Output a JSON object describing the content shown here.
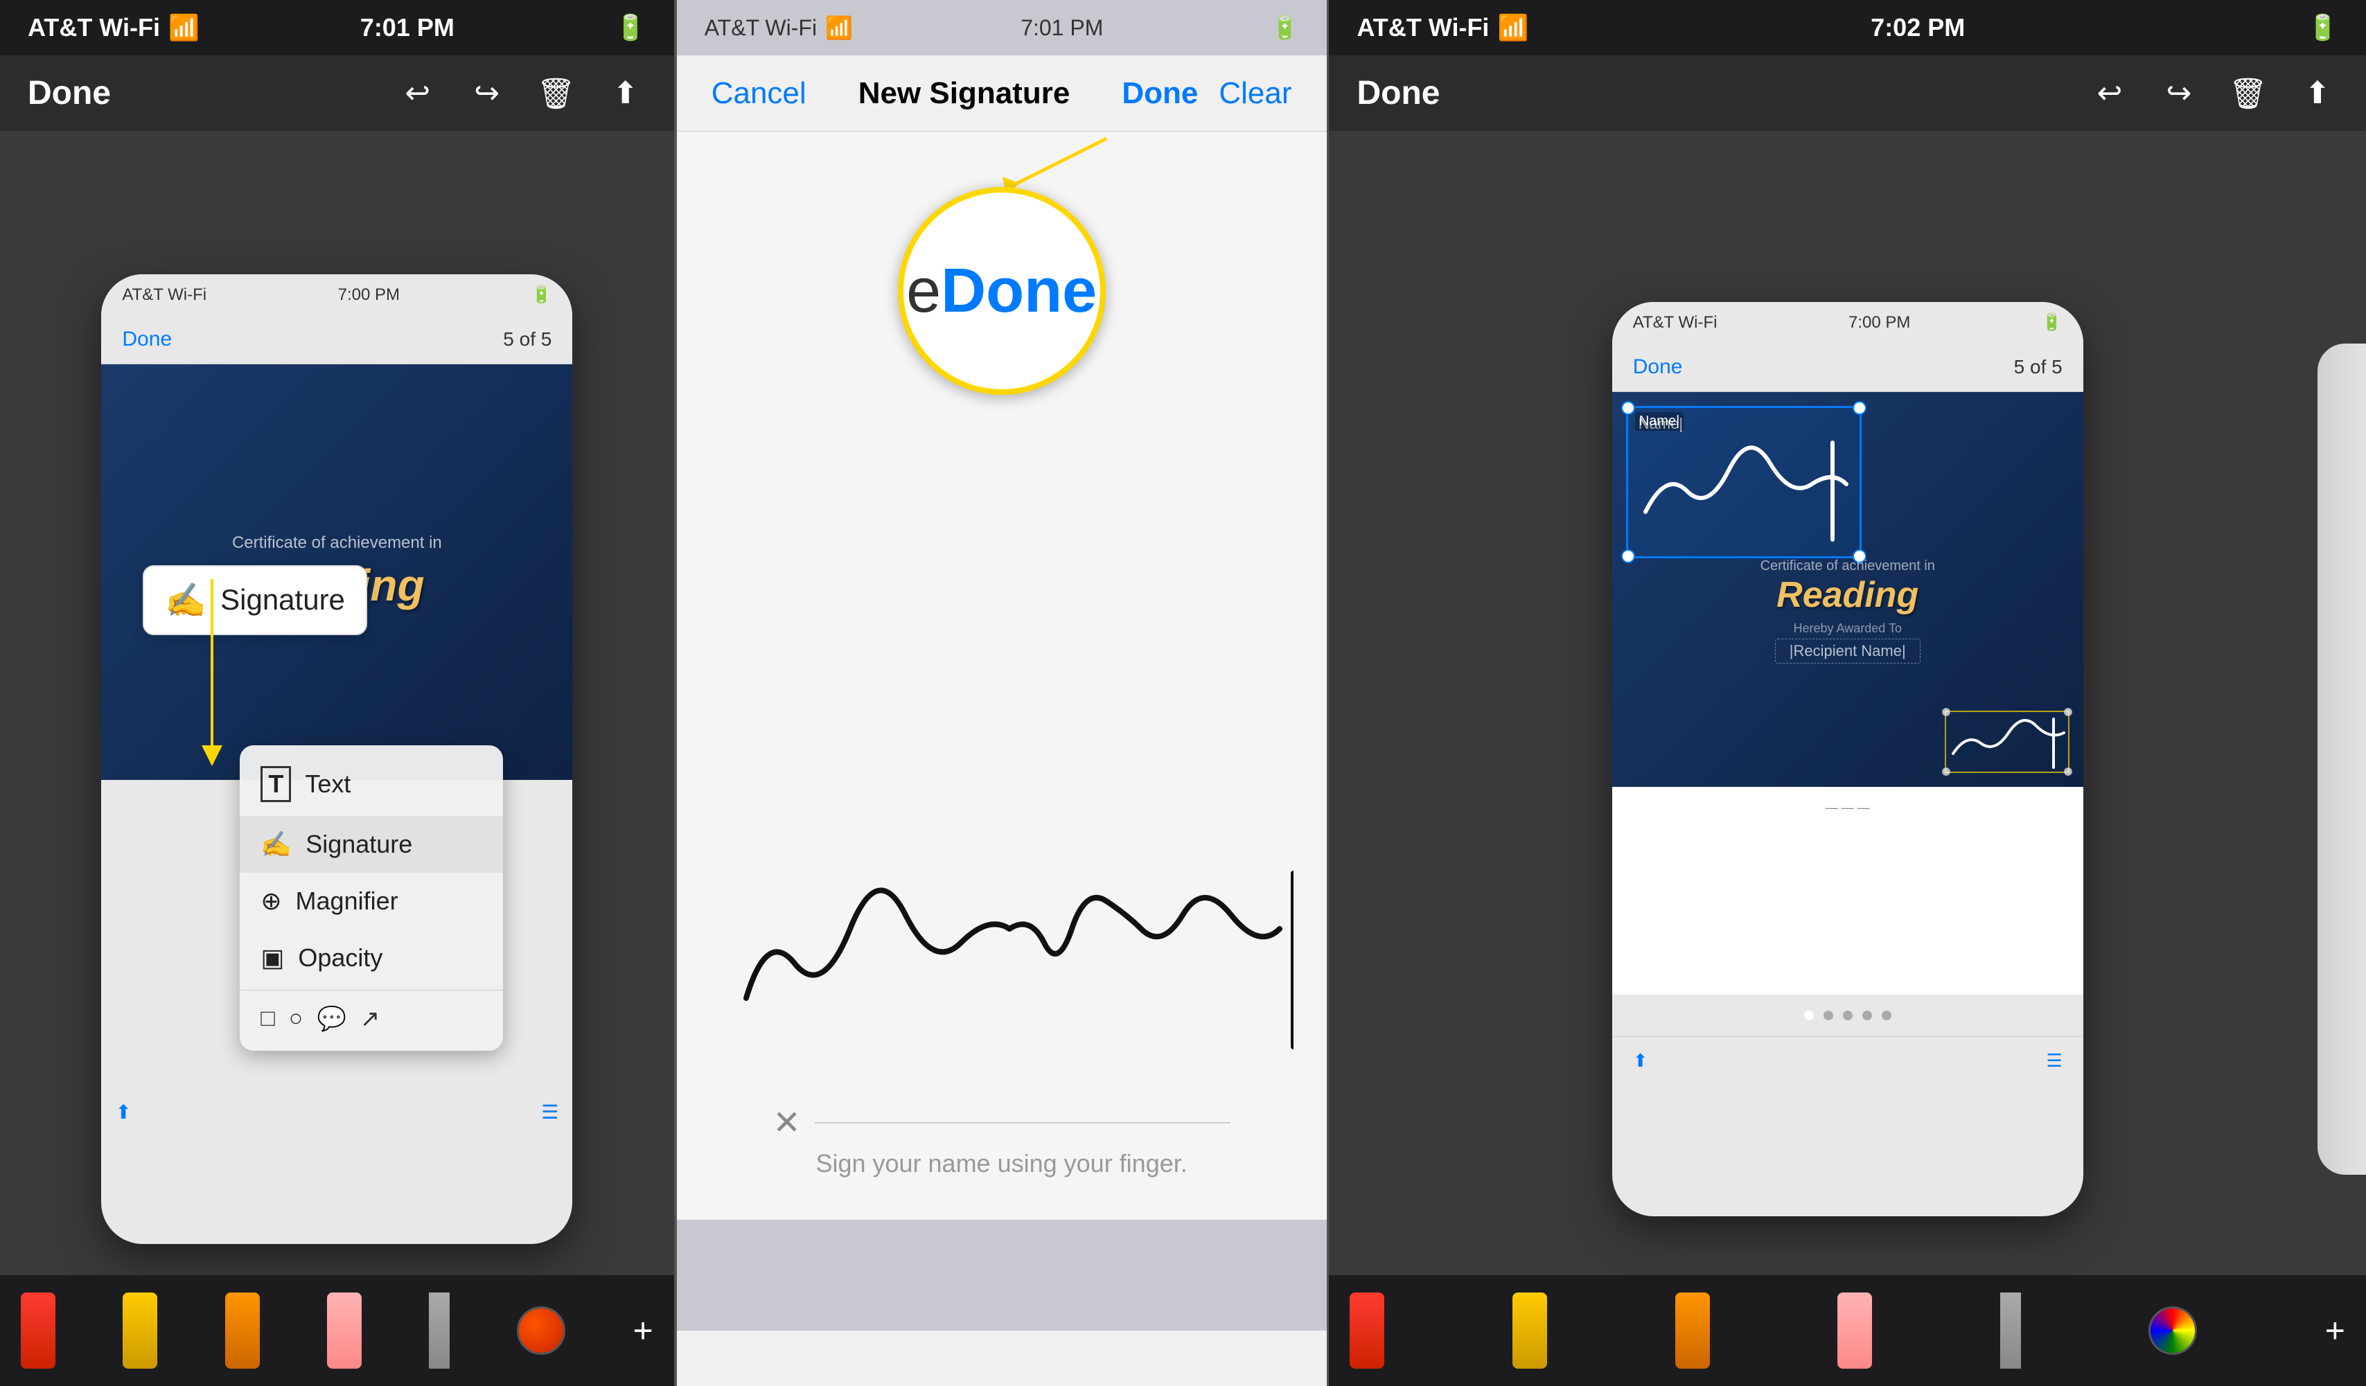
{
  "panel1": {
    "status": {
      "carrier": "AT&T Wi-Fi",
      "time": "7:01 PM",
      "battery": "▓▓▓"
    },
    "toolbar": {
      "done_label": "Done",
      "icons": [
        "↩",
        "↪",
        "🗑",
        "⬆"
      ]
    },
    "phone": {
      "carrier": "AT&T Wi-Fi",
      "time": "7:00 PM",
      "done_label": "Done",
      "page_info": "5 of 5"
    },
    "certificate": {
      "subtitle": "Certificate of achievement in",
      "title": "Reading"
    },
    "signature_tooltip": {
      "label": "Signature"
    },
    "dropdown": {
      "items": [
        {
          "icon": "T",
          "label": "Text"
        },
        {
          "icon": "✍",
          "label": "Signature"
        },
        {
          "icon": "⊕",
          "label": "Magnifier"
        },
        {
          "icon": "▣",
          "label": "Opacity"
        }
      ],
      "shapes": [
        "□",
        "○",
        "💬",
        "↗"
      ]
    }
  },
  "panel2": {
    "status": {
      "carrier": "AT&T Wi-Fi",
      "time": "7:01 PM"
    },
    "header": {
      "cancel_label": "Cancel",
      "title": "New Signature",
      "done_label": "Done",
      "clear_label": "Clear"
    },
    "magnifier": {
      "edge_text": "e",
      "done_text": "Done"
    },
    "sign_prompt": "Sign your name using your finger."
  },
  "panel3": {
    "status": {
      "carrier": "AT&T Wi-Fi",
      "time": "7:02 PM",
      "battery": "▓▓▓"
    },
    "toolbar": {
      "done_label": "Done",
      "icons": [
        "↩",
        "↪",
        "🗑",
        "⬆"
      ]
    },
    "phone": {
      "carrier": "AT&T Wi-Fi",
      "time": "7:00 PM",
      "done_label": "Done",
      "page_info": "5 of 5"
    },
    "certificate": {
      "subtitle": "Certificate of achievement in",
      "title": "Reading",
      "recipient_label": "|Recipient Name|"
    },
    "signature_box": {
      "name_label": "Name|"
    }
  }
}
